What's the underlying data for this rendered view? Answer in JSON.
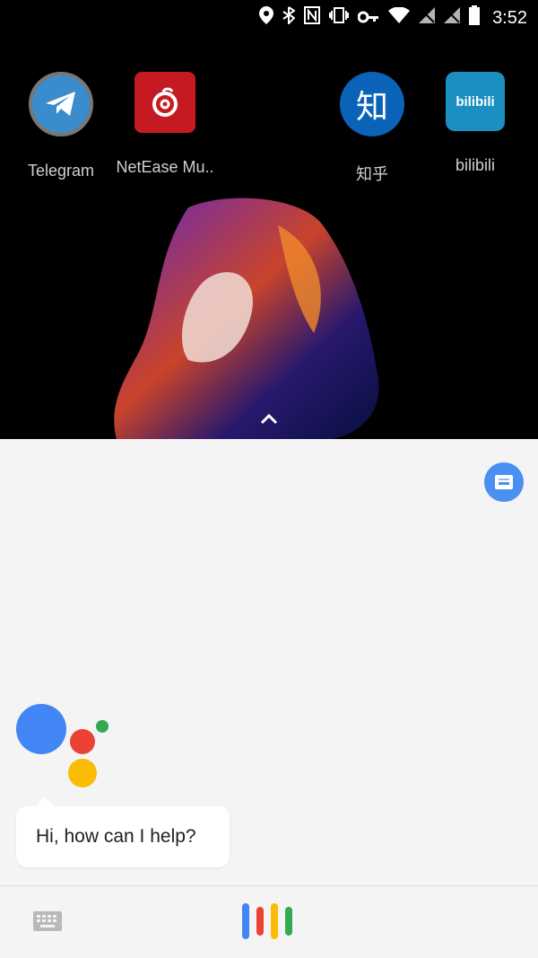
{
  "status_bar": {
    "time": "3:52",
    "icons": [
      "location-icon",
      "bluetooth-icon",
      "nfc-icon",
      "vibrate-icon",
      "vpn-key-icon",
      "wifi-icon",
      "signal-off-icon",
      "signal-off-icon",
      "battery-icon"
    ]
  },
  "home_screen": {
    "apps": [
      {
        "label": "Telegram",
        "icon": "telegram-icon",
        "color": "#3b8fd3"
      },
      {
        "label": "NetEase Mu..",
        "icon": "netease-music-icon",
        "color": "#d21f2a"
      },
      {
        "label": "知乎",
        "icon": "zhihu-icon",
        "icon_text": "知",
        "color": "#0a66c2"
      },
      {
        "label": "bilibili",
        "icon": "bilibili-icon",
        "icon_text": "bilibili",
        "color": "#1ea0d7"
      }
    ],
    "swipe_up_icon": "chevron-up-icon"
  },
  "assistant": {
    "greeting": "Hi, how can I help?",
    "top_right_icon": "assistant-drawer-icon",
    "logo_colors": {
      "blue": "#4285f4",
      "red": "#ea4335",
      "yellow": "#fbbc05",
      "green": "#34a853"
    },
    "bottom_bar": {
      "keyboard_icon": "keyboard-icon",
      "mic_icon": "voice-bars-icon"
    }
  }
}
